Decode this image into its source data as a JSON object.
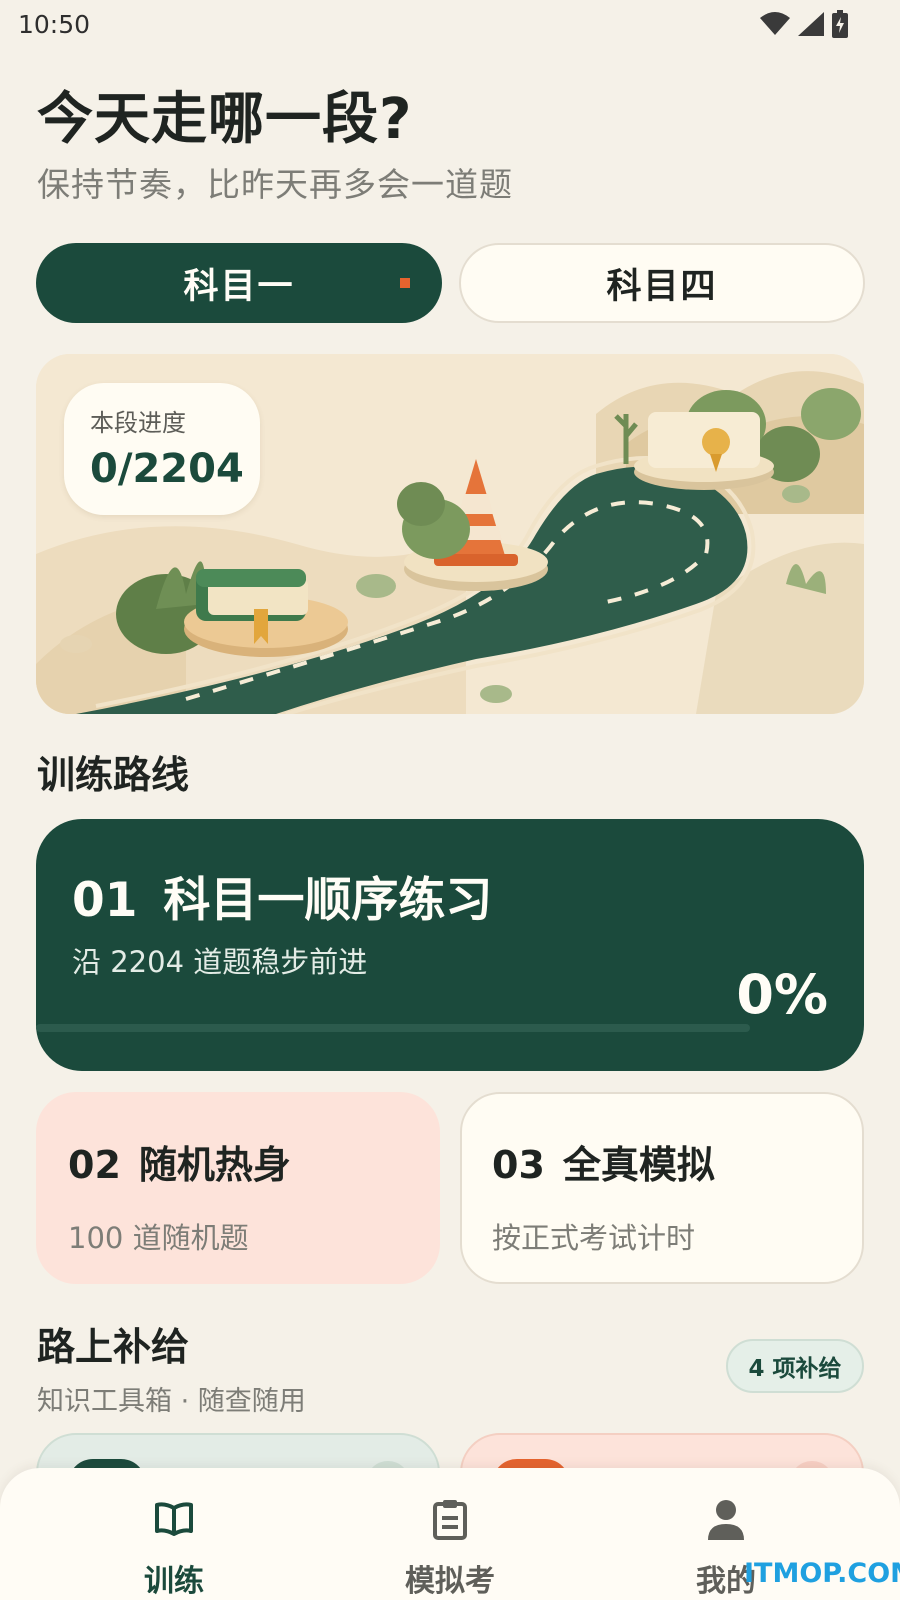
{
  "status_bar": {
    "time": "10:50"
  },
  "hero": {
    "title": "今天走哪一段?",
    "subtitle": "保持节奏，比昨天再多会一道题"
  },
  "subject_tabs": [
    {
      "label": "科目一",
      "active": true
    },
    {
      "label": "科目四",
      "active": false
    }
  ],
  "progress": {
    "label": "本段进度",
    "value": "0/2204"
  },
  "training": {
    "section_title": "训练路线",
    "main_route": {
      "number": "01",
      "title": "科目一顺序练习",
      "subtitle": "沿 2204 道题稳步前进",
      "percent": "0%",
      "progress_fraction": 0
    },
    "routes": [
      {
        "number": "02",
        "title": "随机热身",
        "subtitle": "100 道随机题"
      },
      {
        "number": "03",
        "title": "全真模拟",
        "subtitle": "按正式考试计时"
      }
    ]
  },
  "supplies": {
    "section_title": "路上补给",
    "subtitle": "知识工具箱 · 随查随用",
    "badge": "4 项补给"
  },
  "bottom_nav": {
    "items": [
      {
        "label": "训练",
        "icon": "open-book-icon",
        "active": true
      },
      {
        "label": "模拟考",
        "icon": "clipboard-icon",
        "active": false
      },
      {
        "label": "我的",
        "icon": "person-icon",
        "active": false
      }
    ]
  },
  "watermark": "ITMOP.COM",
  "colors": {
    "primary": "#1b4a3c",
    "background": "#f5f1e8",
    "accent_orange": "#e5632e",
    "warm_card": "#fde3da",
    "mint_card": "#e3ece6"
  }
}
